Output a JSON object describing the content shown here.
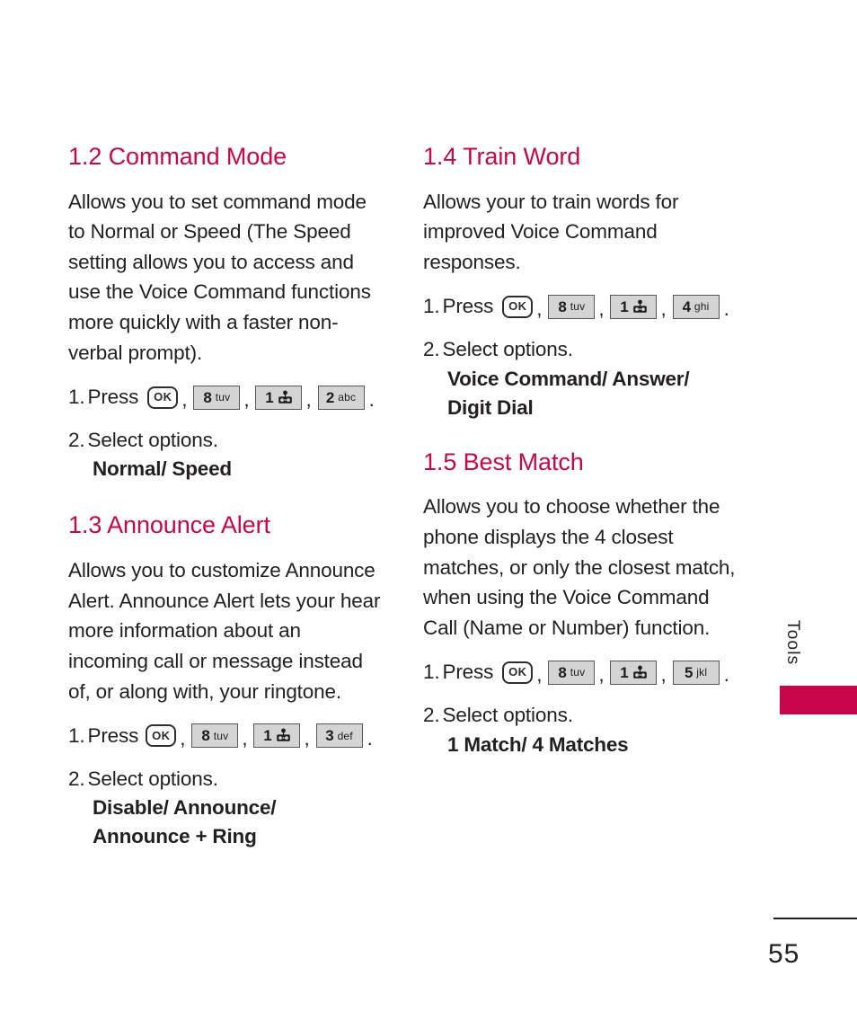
{
  "page": {
    "number": "55",
    "side_tab_label": "Tools",
    "accent_color": "#c8064c",
    "text_color": "#231f20"
  },
  "keys": {
    "ok_label": "OK",
    "k8": {
      "digit": "8",
      "letters": "tuv"
    },
    "k1": {
      "digit": "1",
      "letters": "",
      "icon": "voicemail-icon"
    },
    "k2": {
      "digit": "2",
      "letters": "abc"
    },
    "k3": {
      "digit": "3",
      "letters": "def"
    },
    "k4": {
      "digit": "4",
      "letters": "ghi"
    },
    "k5": {
      "digit": "5",
      "letters": "jkl"
    },
    "separator": ",",
    "terminator": "."
  },
  "sections": {
    "command_mode": {
      "heading": "1.2 Command Mode",
      "body": "Allows you to set command mode to Normal or Speed (The Speed setting allows you to access and use the Voice Command functions more quickly with a faster non-verbal prompt).",
      "step1_num": "1.",
      "step1_text": "Press",
      "step2_num": "2.",
      "step2_text": "Select options.",
      "options": "Normal/ Speed"
    },
    "announce_alert": {
      "heading": "1.3 Announce Alert",
      "body": "Allows you to customize Announce Alert. Announce Alert lets your hear more information about an incoming call or message instead of, or along with, your ringtone.",
      "step1_num": "1.",
      "step1_text": "Press",
      "step2_num": "2.",
      "step2_text": "Select options.",
      "options": "Disable/ Announce/\nAnnounce + Ring"
    },
    "train_word": {
      "heading": "1.4 Train Word",
      "body": "Allows your to train words for improved Voice Command responses.",
      "step1_num": "1.",
      "step1_text": "Press",
      "step2_num": "2.",
      "step2_text": "Select options.",
      "options": "Voice Command/ Answer/\nDigit Dial"
    },
    "best_match": {
      "heading": "1.5 Best Match",
      "body": "Allows you to choose whether the phone displays the 4 closest matches, or only the closest match, when using the Voice Command Call (Name or Number) function.",
      "step1_num": "1.",
      "step1_text": "Press",
      "step2_num": "2.",
      "step2_text": "Select options.",
      "options": "1 Match/ 4 Matches"
    }
  }
}
